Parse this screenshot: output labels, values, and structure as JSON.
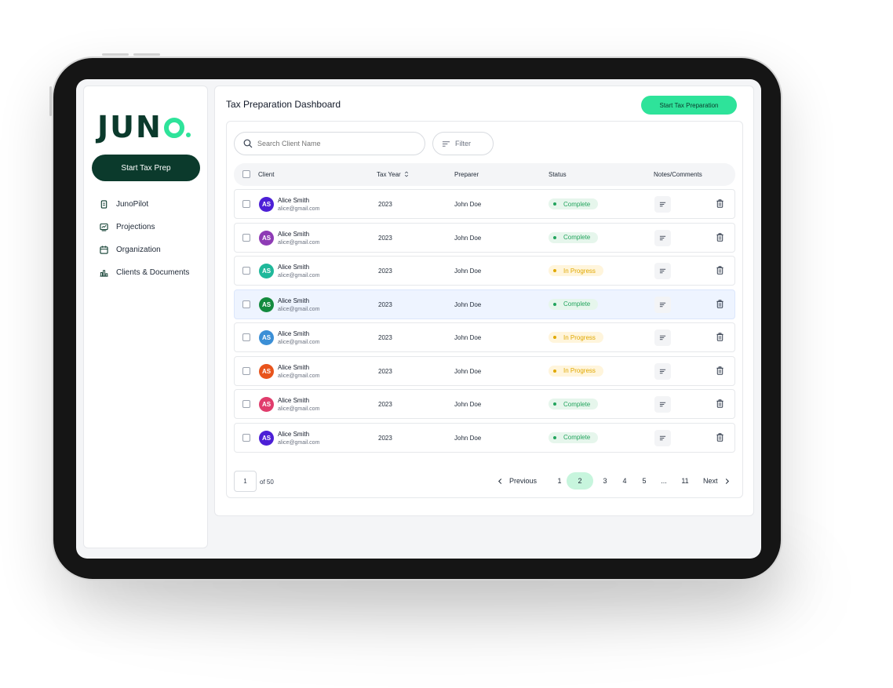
{
  "colors": {
    "brand_dark": "#0b3a2c",
    "brand_accent": "#2ee39a",
    "complete_bg": "#e6f6ec",
    "complete_text": "#22a45d",
    "progress_bg": "#fff5dc",
    "progress_text": "#e0a800"
  },
  "sidebar": {
    "logo": "JUNO",
    "cta_label": "Start Tax Prep",
    "items": [
      {
        "label": "JunoPilot",
        "icon": "document-icon"
      },
      {
        "label": "Projections",
        "icon": "chart-icon"
      },
      {
        "label": "Organization",
        "icon": "calendar-icon"
      },
      {
        "label": "Clients & Documents",
        "icon": "bar-chart-icon"
      }
    ]
  },
  "main": {
    "title": "Tax Preparation Dashboard",
    "cta_label": "Start Tax Preparation",
    "search_placeholder": "Search Client Name",
    "filter_label": "Filter",
    "columns": {
      "client": "Client",
      "tax_year": "Tax Year",
      "preparer": "Preparer",
      "status": "Status",
      "notes": "Notes/Comments"
    },
    "rows": [
      {
        "initials": "AS",
        "avatar_color": "#4c1fd6",
        "name": "Alice Smith",
        "email": "alice@gmail.com",
        "year": "2023",
        "preparer": "John Doe",
        "status": "Complete"
      },
      {
        "initials": "AS",
        "avatar_color": "#8e3bb5",
        "name": "Alice Smith",
        "email": "alice@gmail.com",
        "year": "2023",
        "preparer": "John Doe",
        "status": "Complete"
      },
      {
        "initials": "AS",
        "avatar_color": "#1fb89a",
        "name": "Alice Smith",
        "email": "alice@gmail.com",
        "year": "2023",
        "preparer": "John Doe",
        "status": "In Progress"
      },
      {
        "initials": "AS",
        "avatar_color": "#138a3e",
        "name": "Alice Smith",
        "email": "alice@gmail.com",
        "year": "2023",
        "preparer": "John Doe",
        "status": "Complete"
      },
      {
        "initials": "AS",
        "avatar_color": "#3b8fd6",
        "name": "Alice Smith",
        "email": "alice@gmail.com",
        "year": "2023",
        "preparer": "John Doe",
        "status": "In Progress"
      },
      {
        "initials": "AS",
        "avatar_color": "#e8541c",
        "name": "Alice Smith",
        "email": "alice@gmail.com",
        "year": "2023",
        "preparer": "John Doe",
        "status": "In Progress"
      },
      {
        "initials": "AS",
        "avatar_color": "#e03c6c",
        "name": "Alice Smith",
        "email": "alice@gmail.com",
        "year": "2023",
        "preparer": "John Doe",
        "status": "Complete"
      },
      {
        "initials": "AS",
        "avatar_color": "#4c1fd6",
        "name": "Alice Smith",
        "email": "alice@gmail.com",
        "year": "2023",
        "preparer": "John Doe",
        "status": "Complete"
      }
    ],
    "highlighted_row": 4,
    "pagination": {
      "current_page_input": "1",
      "of_total": "of 50",
      "previous_label": "Previous",
      "next_label": "Next",
      "pages": [
        "1",
        "2",
        "3",
        "4",
        "5",
        "...",
        "11"
      ],
      "active_page": "2"
    }
  }
}
